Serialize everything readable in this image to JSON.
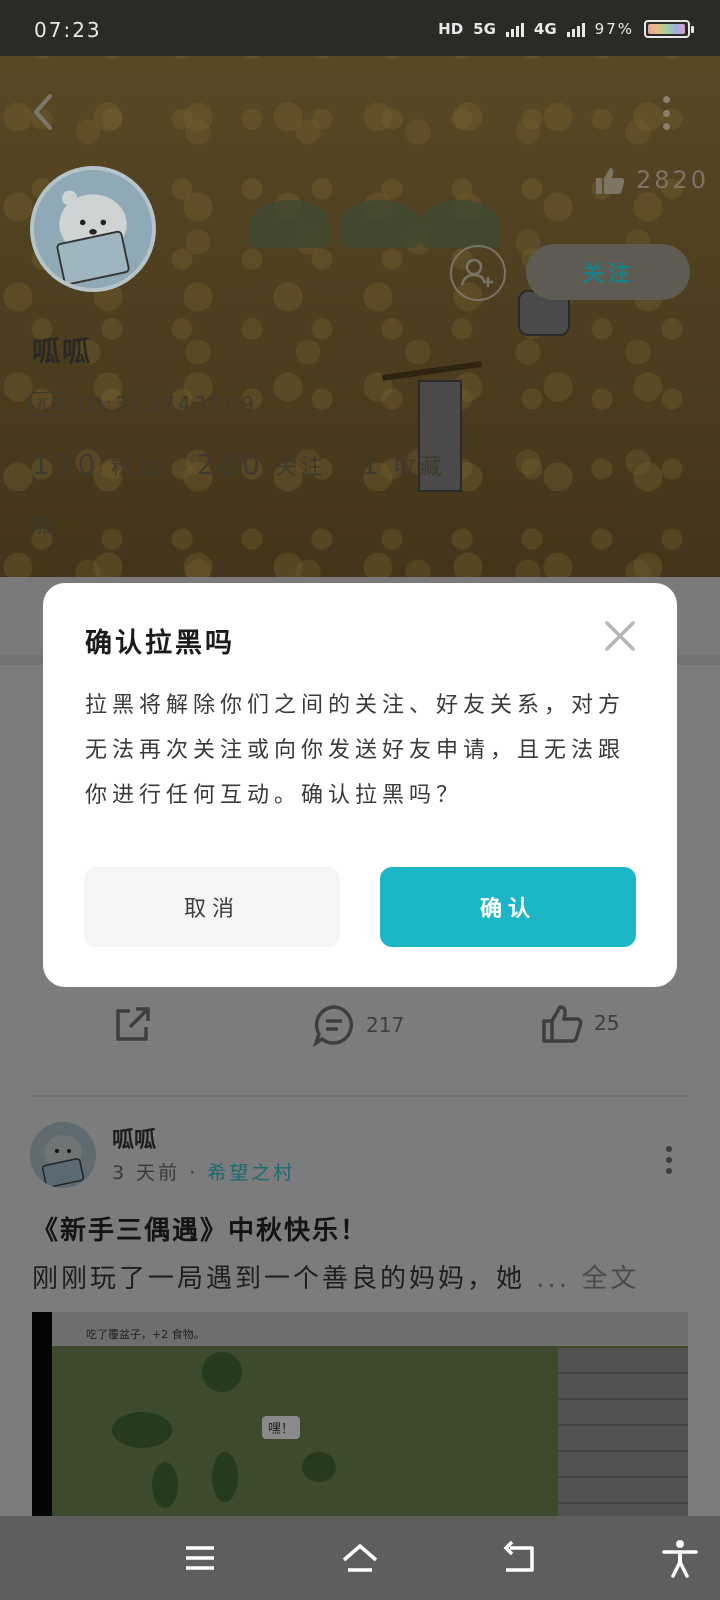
{
  "status_bar": {
    "time": "07:23",
    "network_hd": "HD",
    "network_5g": "5G",
    "network_4g": "4G",
    "battery": "97%",
    "battery_level": 0.97
  },
  "profile": {
    "username": "呱呱",
    "badge": "礼仪",
    "id_text": "ID:365743709",
    "likes": "2820",
    "follow_label": "关注",
    "stats": [
      {
        "num": "130",
        "label": "粉丝"
      },
      {
        "num": "280",
        "label": "关注"
      },
      {
        "num": "1",
        "label": "收藏"
      }
    ],
    "bio": "呱"
  },
  "feed": {
    "post1_actions": {
      "comments": "217",
      "likes": "25"
    },
    "post2": {
      "author": "呱呱",
      "time": "3 天前",
      "separator": "·",
      "tag": "希望之村",
      "title": "《新手三偶遇》中秋快乐！",
      "excerpt": "刚刚玩了一局遇到一个善良的妈妈，她",
      "more": "... 全文",
      "image_hint": "吃了覆盆子，+2 食物。",
      "image_speech": "嘿！"
    }
  },
  "dialog": {
    "title": "确认拉黑吗",
    "body": "拉黑将解除你们之间的关注、好友关系，对方无法再次关注或向你发送好友申请，且无法跟你进行任何互动。确认拉黑吗？",
    "cancel_label": "取消",
    "confirm_label": "确认",
    "confirm_color": "#1cb6c6"
  },
  "navbar": {
    "icons": [
      "menu-icon",
      "home-icon",
      "back-icon",
      "accessibility-icon"
    ]
  }
}
